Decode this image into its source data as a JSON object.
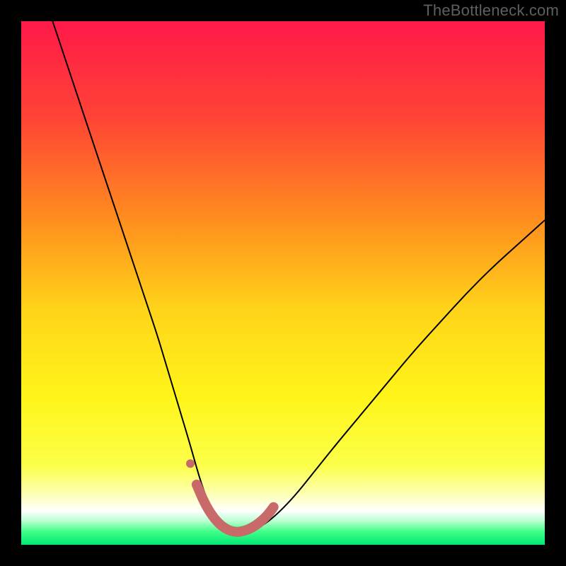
{
  "watermark": "TheBottleneck.com",
  "chart_data": {
    "type": "line",
    "title": "",
    "xlabel": "",
    "ylabel": "",
    "xlim": [
      0,
      100
    ],
    "ylim": [
      0,
      100
    ],
    "gradient_stops": [
      {
        "offset": 0.0,
        "color": "#ff1a49"
      },
      {
        "offset": 0.18,
        "color": "#ff4236"
      },
      {
        "offset": 0.38,
        "color": "#ff8e1e"
      },
      {
        "offset": 0.55,
        "color": "#ffd41a"
      },
      {
        "offset": 0.72,
        "color": "#fff51a"
      },
      {
        "offset": 0.85,
        "color": "#fbff4a"
      },
      {
        "offset": 0.905,
        "color": "#fdffb8"
      },
      {
        "offset": 0.935,
        "color": "#ffffff"
      },
      {
        "offset": 0.955,
        "color": "#b8ffcf"
      },
      {
        "offset": 0.975,
        "color": "#3fff88"
      },
      {
        "offset": 1.0,
        "color": "#00e874"
      }
    ],
    "series": [
      {
        "name": "bottleneck-curve",
        "stroke": "#000000",
        "stroke_width": 2,
        "x": [
          6,
          8,
          10,
          12,
          14,
          16,
          18,
          20,
          22,
          24,
          26,
          27.5,
          29,
          30.5,
          32,
          33,
          34,
          35,
          36,
          37,
          38,
          39,
          40,
          41.5,
          43,
          45,
          48,
          52,
          56,
          60,
          65,
          70,
          75,
          80,
          85,
          90,
          95,
          100
        ],
        "values": [
          100,
          94,
          88,
          82,
          76,
          70,
          64,
          58,
          52,
          46,
          40,
          35,
          30,
          25,
          20,
          16.5,
          13,
          10,
          7.5,
          5.5,
          4,
          3,
          2.4,
          2.2,
          2.4,
          3,
          5,
          9,
          14,
          19,
          25,
          31,
          37,
          42.5,
          48,
          53,
          57.5,
          62
        ]
      },
      {
        "name": "bottleneck-highlight",
        "stroke": "#c96a6a",
        "stroke_width": 14,
        "linecap": "round",
        "x": [
          33.5,
          35,
          36.5,
          38,
          39.5,
          41,
          42.5,
          44,
          45.5,
          47,
          48.2
        ],
        "values": [
          11.5,
          8,
          5.5,
          3.8,
          2.8,
          2.4,
          2.6,
          3.2,
          4.2,
          5.6,
          7.2
        ]
      }
    ],
    "markers": [
      {
        "name": "highlight-dot",
        "x": 32.3,
        "y": 15.5,
        "r": 6,
        "fill": "#c96a6a"
      }
    ]
  }
}
